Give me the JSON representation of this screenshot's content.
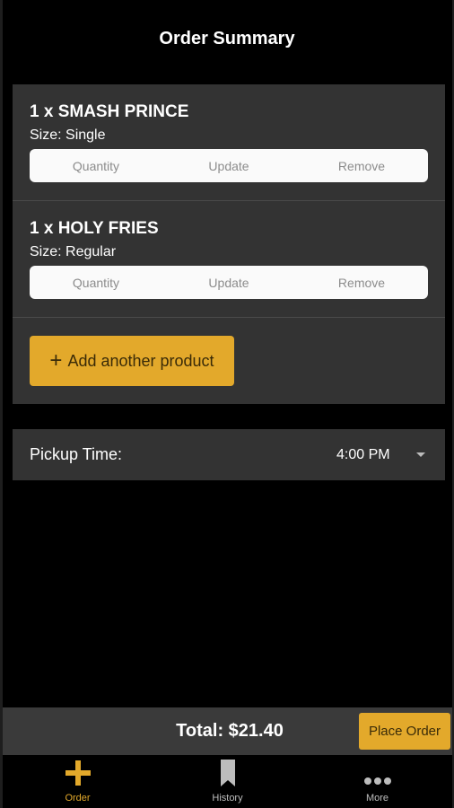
{
  "header": {
    "title": "Order Summary"
  },
  "order": {
    "items": [
      {
        "title": "1 x SMASH PRINCE",
        "size": "Size: Single",
        "actions": {
          "quantity": "Quantity",
          "update": "Update",
          "remove": "Remove"
        }
      },
      {
        "title": "1 x HOLY FRIES",
        "size": "Size: Regular",
        "actions": {
          "quantity": "Quantity",
          "update": "Update",
          "remove": "Remove"
        }
      }
    ],
    "add_button": "Add another product",
    "add_button_icon": "plus-icon"
  },
  "pickup": {
    "label": "Pickup Time:",
    "value": "4:00 PM",
    "icon": "chevron-down-icon"
  },
  "footer": {
    "total": "Total: $21.40",
    "place_order": "Place Order"
  },
  "tabs": [
    {
      "label": "Order",
      "icon": "plus-icon",
      "active": true
    },
    {
      "label": "History",
      "icon": "bookmark-icon",
      "active": false
    },
    {
      "label": "More",
      "icon": "more-dots-icon",
      "active": false
    }
  ],
  "colors": {
    "accent": "#e3a92b",
    "card": "#333333",
    "background": "#000000"
  }
}
